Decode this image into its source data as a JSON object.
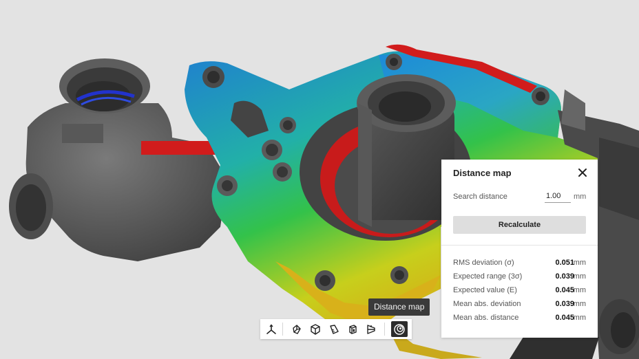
{
  "viewport": {
    "scene_label": "3D scan of engine pump housing with distance map overlay"
  },
  "panel": {
    "title": "Distance map",
    "close_icon": "close-icon",
    "search_distance_label": "Search distance",
    "search_distance_value": "1.00",
    "search_distance_unit": "mm",
    "recalculate_label": "Recalculate",
    "stats": [
      {
        "label": "RMS deviation (σ)",
        "value": "0.051",
        "unit": "mm"
      },
      {
        "label": "Expected range (3σ)",
        "value": "0.039",
        "unit": "mm"
      },
      {
        "label": "Expected value (E)",
        "value": "0.045",
        "unit": "mm"
      },
      {
        "label": "Mean abs. deviation",
        "value": "0.039",
        "unit": "mm"
      },
      {
        "label": "Mean abs. distance",
        "value": "0.045",
        "unit": "mm"
      }
    ]
  },
  "tooltip": {
    "text": "Distance map"
  },
  "toolbar": {
    "tools": [
      {
        "icon": "axes-icon"
      },
      {
        "icon": "view-front-icon"
      },
      {
        "icon": "view-iso-icon"
      },
      {
        "icon": "view-side-icon"
      },
      {
        "icon": "view-top-icon"
      },
      {
        "icon": "view-section-icon"
      },
      {
        "icon": "distance-map-icon",
        "active": true
      }
    ]
  },
  "colors": {
    "background": "#e3e3e3",
    "deviation_high": "#d91f1f",
    "deviation_mid": "#f0d000",
    "deviation_ok": "#2fb84a",
    "deviation_low": "#1a8fd6",
    "deviation_min": "#1a3fd6",
    "active_tool": "#2c2c2c"
  }
}
